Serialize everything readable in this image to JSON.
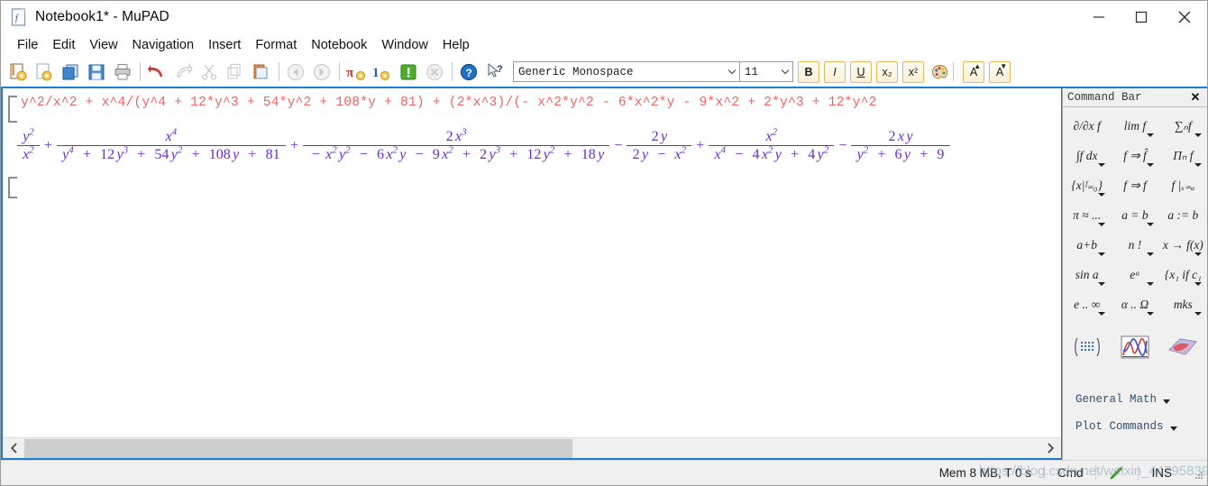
{
  "window": {
    "title": "Notebook1* - MuPAD",
    "icon": "mupad-document-icon",
    "minimize": "–",
    "maximize": "□",
    "close": "✕"
  },
  "menubar": {
    "items": [
      {
        "label": "File"
      },
      {
        "label": "Edit"
      },
      {
        "label": "View"
      },
      {
        "label": "Navigation"
      },
      {
        "label": "Insert"
      },
      {
        "label": "Format"
      },
      {
        "label": "Notebook"
      },
      {
        "label": "Window"
      },
      {
        "label": "Help"
      }
    ]
  },
  "toolbar": {
    "buttons": [
      {
        "name": "new-notebook-icon",
        "enabled": true
      },
      {
        "name": "open-notebook-icon",
        "enabled": true
      },
      {
        "name": "open-recent-icon",
        "enabled": true
      },
      {
        "name": "save-icon",
        "enabled": true
      },
      {
        "name": "print-icon",
        "enabled": true
      },
      {
        "name": "undo-icon",
        "enabled": true
      },
      {
        "name": "redo-icon",
        "enabled": false
      },
      {
        "name": "cut-icon",
        "enabled": false
      },
      {
        "name": "copy-icon",
        "enabled": false
      },
      {
        "name": "paste-icon",
        "enabled": true
      },
      {
        "name": "back-icon",
        "enabled": false
      },
      {
        "name": "forward-icon",
        "enabled": false
      },
      {
        "name": "evaluate-pi-icon",
        "enabled": true
      },
      {
        "name": "evaluate-all-icon",
        "enabled": true
      },
      {
        "name": "interrupt-icon",
        "enabled": true
      },
      {
        "name": "stop-icon",
        "enabled": false
      },
      {
        "name": "help-icon",
        "enabled": true
      },
      {
        "name": "context-help-icon",
        "enabled": true
      }
    ],
    "font_family": "Generic Monospace",
    "font_size": "11",
    "format_buttons": [
      {
        "name": "bold-button",
        "label": "B"
      },
      {
        "name": "italic-button",
        "label": "I"
      },
      {
        "name": "underline-button",
        "label": "U"
      },
      {
        "name": "subscript-button",
        "label": "x₂"
      },
      {
        "name": "superscript-button",
        "label": "x²"
      },
      {
        "name": "text-color-button",
        "label": ""
      },
      {
        "name": "increase-font-button",
        "label": "A"
      },
      {
        "name": "decrease-font-button",
        "label": "A"
      }
    ]
  },
  "document": {
    "input_code": "y^2/x^2 + x^4/(y^4 + 12*y^3 + 54*y^2 + 108*y + 81) + (2*x^3)/(- x^2*y^2 - 6*x^2*y - 9*x^2 + 2*y^3 + 12*y^2",
    "output_color": "#6c28d8",
    "input_color": "#f6625f",
    "expression_terms": [
      {
        "operator": "",
        "num_tokens": [
          {
            "t": "y",
            "sup": "2"
          }
        ],
        "den_tokens": [
          {
            "t": "x",
            "sup": "2"
          }
        ]
      },
      {
        "operator": "+",
        "num_tokens": [
          {
            "t": "x",
            "sup": "4"
          }
        ],
        "den_tokens": [
          {
            "t": "y",
            "sup": "4"
          },
          {
            "t": " + ",
            "op": true
          },
          {
            "t": "12",
            "lit": true
          },
          {
            "t": "y",
            "sup": "3"
          },
          {
            "t": " + ",
            "op": true
          },
          {
            "t": "54",
            "lit": true
          },
          {
            "t": "y",
            "sup": "2"
          },
          {
            "t": " + ",
            "op": true
          },
          {
            "t": "108",
            "lit": true
          },
          {
            "t": "y",
            "sup": ""
          },
          {
            "t": " + ",
            "op": true
          },
          {
            "t": "81",
            "lit": true
          }
        ]
      },
      {
        "operator": "+",
        "num_tokens": [
          {
            "t": "2",
            "lit": true
          },
          {
            "t": "x",
            "sup": "3"
          }
        ],
        "den_tokens": [
          {
            "t": "−",
            "op": true
          },
          {
            "t": "x",
            "sup": "2"
          },
          {
            "t": "y",
            "sup": "2"
          },
          {
            "t": " − ",
            "op": true
          },
          {
            "t": "6",
            "lit": true
          },
          {
            "t": "x",
            "sup": "2"
          },
          {
            "t": "y",
            "sup": ""
          },
          {
            "t": " − ",
            "op": true
          },
          {
            "t": "9",
            "lit": true
          },
          {
            "t": "x",
            "sup": "2"
          },
          {
            "t": " + ",
            "op": true
          },
          {
            "t": "2",
            "lit": true
          },
          {
            "t": "y",
            "sup": "3"
          },
          {
            "t": " + ",
            "op": true
          },
          {
            "t": "12",
            "lit": true
          },
          {
            "t": "y",
            "sup": "2"
          },
          {
            "t": " + ",
            "op": true
          },
          {
            "t": "18",
            "lit": true
          },
          {
            "t": "y",
            "sup": ""
          }
        ]
      },
      {
        "operator": "−",
        "num_tokens": [
          {
            "t": "2",
            "lit": true
          },
          {
            "t": "y",
            "sup": ""
          }
        ],
        "den_tokens": [
          {
            "t": "2",
            "lit": true
          },
          {
            "t": "y",
            "sup": ""
          },
          {
            "t": " − ",
            "op": true
          },
          {
            "t": "x",
            "sup": "2"
          }
        ]
      },
      {
        "operator": "+",
        "num_tokens": [
          {
            "t": "x",
            "sup": "2"
          }
        ],
        "den_tokens": [
          {
            "t": "x",
            "sup": "4"
          },
          {
            "t": " − ",
            "op": true
          },
          {
            "t": "4",
            "lit": true
          },
          {
            "t": "x",
            "sup": "2"
          },
          {
            "t": "y",
            "sup": ""
          },
          {
            "t": " + ",
            "op": true
          },
          {
            "t": "4",
            "lit": true
          },
          {
            "t": "y",
            "sup": "2"
          }
        ]
      },
      {
        "operator": "−",
        "num_tokens": [
          {
            "t": "2",
            "lit": true
          },
          {
            "t": "x",
            "sup": ""
          },
          {
            "t": "y",
            "sup": ""
          }
        ],
        "den_tokens": [
          {
            "t": "y",
            "sup": "2"
          },
          {
            "t": " + ",
            "op": true
          },
          {
            "t": "6",
            "lit": true
          },
          {
            "t": "y",
            "sup": ""
          },
          {
            "t": " + ",
            "op": true
          },
          {
            "t": "9",
            "lit": true
          }
        ]
      }
    ]
  },
  "command_bar": {
    "title": "Command Bar",
    "close_label": "✕",
    "palette": [
      {
        "name": "partial-derivative-button",
        "glyph": "∂/∂x f",
        "caret": false
      },
      {
        "name": "limit-button",
        "glyph": "lim f",
        "caret": true
      },
      {
        "name": "sum-button",
        "glyph": "∑ₙf",
        "caret": true
      },
      {
        "name": "integral-button",
        "glyph": "∫f dx",
        "caret": true
      },
      {
        "name": "simplify-hat-button",
        "glyph": "f ⇒ f̂",
        "caret": true
      },
      {
        "name": "product-button",
        "glyph": "Πₙ f",
        "caret": true
      },
      {
        "name": "solve-button",
        "glyph": "{x|ᶠ₌₀}",
        "caret": true
      },
      {
        "name": "rewrite-button",
        "glyph": "f ⇒ f",
        "caret": false
      },
      {
        "name": "evaluate-at-button",
        "glyph": "f |ₓ₌ₐ",
        "caret": false
      },
      {
        "name": "numeric-approx-button",
        "glyph": "π ≈ ...",
        "caret": true
      },
      {
        "name": "equation-button",
        "glyph": "a = b",
        "caret": true
      },
      {
        "name": "assignment-button",
        "glyph": "a := b",
        "caret": false
      },
      {
        "name": "arithmetic-button",
        "glyph": "a+b",
        "caret": true
      },
      {
        "name": "factorial-button",
        "glyph": "n !",
        "caret": true
      },
      {
        "name": "function-button",
        "glyph": "x → f(x)",
        "caret": true
      },
      {
        "name": "trig-button",
        "glyph": "sin a",
        "caret": true
      },
      {
        "name": "exponential-button",
        "glyph": "eᵃ",
        "caret": true
      },
      {
        "name": "piecewise-button",
        "glyph": "{x₁ if c₁",
        "caret": true
      },
      {
        "name": "constants-button",
        "glyph": "e .. ∞",
        "caret": true
      },
      {
        "name": "greek-button",
        "glyph": "α .. Ω",
        "caret": true
      },
      {
        "name": "units-button",
        "glyph": "mks",
        "caret": true
      }
    ],
    "icon_buttons": [
      {
        "name": "matrix-palette-icon",
        "caret": true
      },
      {
        "name": "plot2d-icon",
        "caret": false
      },
      {
        "name": "plot3d-icon",
        "caret": false
      }
    ],
    "links": [
      {
        "name": "general-math-link",
        "label": "General Math"
      },
      {
        "name": "plot-commands-link",
        "label": "Plot Commands"
      }
    ]
  },
  "statusbar": {
    "memory": "Mem 8 MB, T 0 s",
    "mode": "Cmd",
    "insert_mode": "INS",
    "pencil_icon": "pencil-icon",
    "watermark": "https://blog.csdn.net/weixin_44795839"
  }
}
